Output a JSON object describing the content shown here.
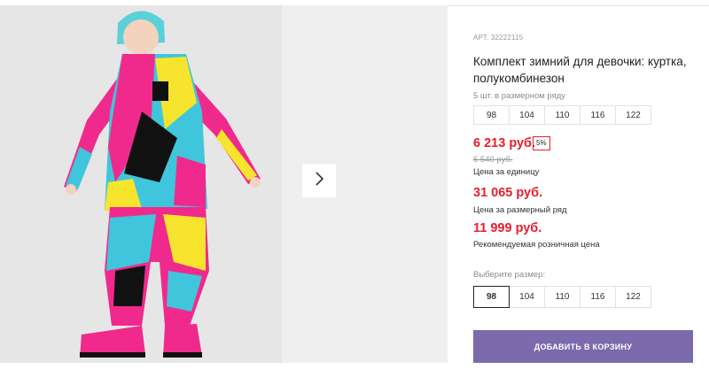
{
  "product": {
    "article": "АРТ. 32222115",
    "title": "Комплект зимний для девочки: куртка, полукомбинезон",
    "pack_note": "5 шт. в размерном ряду",
    "pack_sizes": [
      "98",
      "104",
      "110",
      "116",
      "122"
    ],
    "price": "6 213 руб.",
    "discount_badge": "5%",
    "old_price": "6 540 руб.",
    "price_label": "Цена за единицу",
    "pack_price": "31 065 руб.",
    "pack_price_label": "Цена за размерный ряд",
    "retail_price": "11 999 руб.",
    "retail_price_label": "Рекомендуемая розничная цена"
  },
  "size_select": {
    "label": "Выберите размер:",
    "options": [
      "98",
      "104",
      "110",
      "116",
      "122"
    ],
    "selected": "98"
  },
  "cart_button": "ДОБАВИТЬ В КОРЗИНУ",
  "gallery": {
    "next_icon": "chevron-right-icon"
  },
  "colors": {
    "price_red": "#e5202e",
    "button_purple": "#7b6aac",
    "hat_teal": "#5ad0d8",
    "suit_pink": "#f02a8c",
    "suit_yellow": "#f6e52c",
    "suit_cyan": "#3fc6dc"
  }
}
